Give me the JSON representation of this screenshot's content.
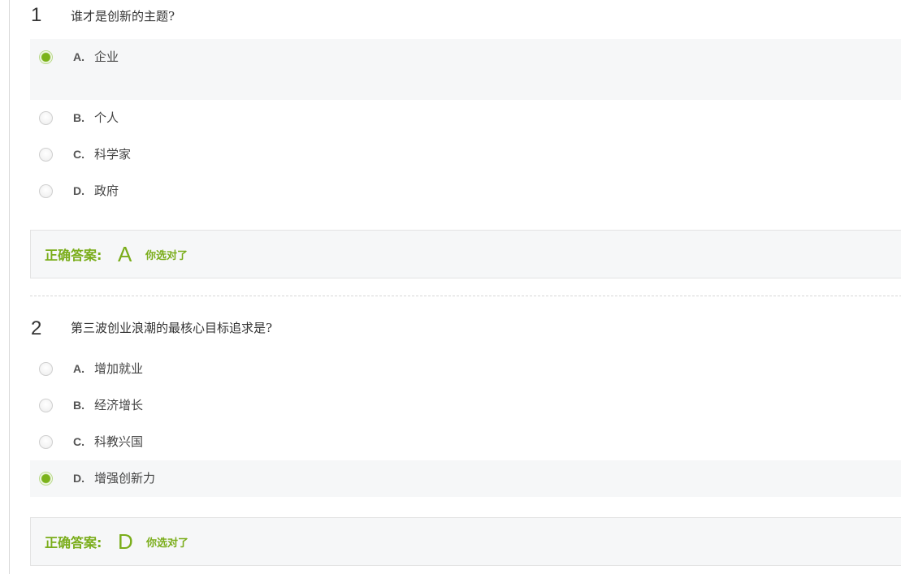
{
  "questions": [
    {
      "number": "1",
      "title": "谁才是创新的主题?",
      "options": [
        {
          "letter": "A.",
          "text": "企业",
          "selected": true
        },
        {
          "letter": "B.",
          "text": "个人",
          "selected": false
        },
        {
          "letter": "C.",
          "text": "科学家",
          "selected": false
        },
        {
          "letter": "D.",
          "text": "政府",
          "selected": false
        }
      ],
      "answer_label": "正确答案:",
      "answer_letter": "A",
      "answer_status": "你选对了"
    },
    {
      "number": "2",
      "title": "第三波创业浪潮的最核心目标追求是?",
      "options": [
        {
          "letter": "A.",
          "text": "增加就业",
          "selected": false
        },
        {
          "letter": "B.",
          "text": "经济增长",
          "selected": false
        },
        {
          "letter": "C.",
          "text": "科教兴国",
          "selected": false
        },
        {
          "letter": "D.",
          "text": "增强创新力",
          "selected": true
        }
      ],
      "answer_label": "正确答案:",
      "answer_letter": "D",
      "answer_status": "你选对了"
    }
  ],
  "colors": {
    "accent_green": "#7aad1a",
    "selected_bg": "#f6f7f8"
  }
}
